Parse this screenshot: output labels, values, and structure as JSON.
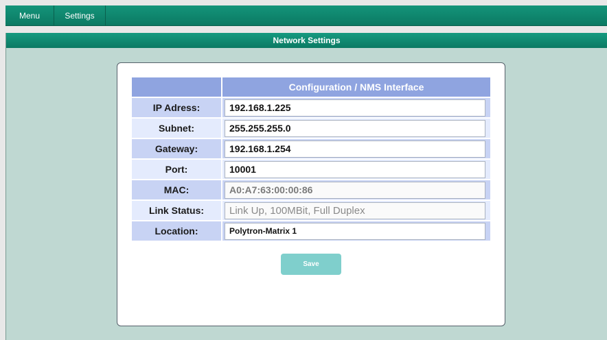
{
  "menu": {
    "items": [
      "Menu",
      "Settings"
    ]
  },
  "panel": {
    "title": "Network Settings"
  },
  "config": {
    "header": "Configuration / NMS Interface",
    "rows": [
      {
        "label": "IP Adress:",
        "value": "192.168.1.225"
      },
      {
        "label": "Subnet:",
        "value": "255.255.255.0"
      },
      {
        "label": "Gateway:",
        "value": "192.168.1.254"
      },
      {
        "label": "Port:",
        "value": "10001"
      },
      {
        "label": "MAC:",
        "value": "A0:A7:63:00:00:86"
      },
      {
        "label": "Link Status:",
        "value": "Link Up, 100MBit, Full Duplex"
      },
      {
        "label": "Location:",
        "value": "Polytron-Matrix 1"
      }
    ]
  },
  "save_label": "Save",
  "colors": {
    "topbar": "#0b7a63",
    "panel_bg": "#bfd8d2",
    "table_header": "#8fa4e0",
    "row_odd": "#c8d3f4",
    "row_even": "#e4ebfd",
    "save_button": "#7fcfcc"
  }
}
